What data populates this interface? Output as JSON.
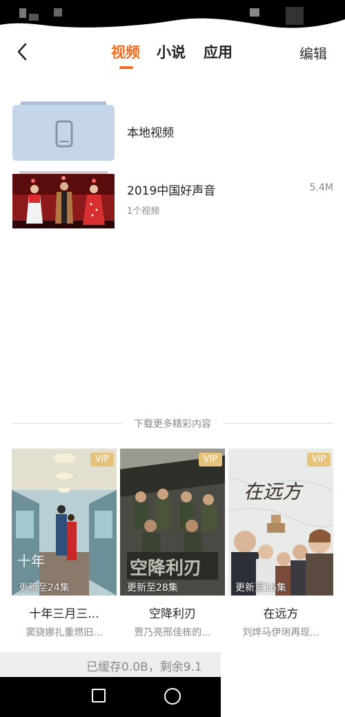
{
  "header": {
    "tabs": [
      {
        "label": "视频",
        "active": true
      },
      {
        "label": "小说",
        "active": false
      },
      {
        "label": "应用",
        "active": false
      }
    ],
    "edit_label": "编辑",
    "accent_color": "#f26b1d"
  },
  "local_video": {
    "label": "本地视频",
    "icon": "phone-icon"
  },
  "folder": {
    "title": "2019中国好声音",
    "count": "1个视频",
    "size": "5.4M"
  },
  "divider_text": "下载更多精彩内容",
  "cards": [
    {
      "badge": "VIP",
      "update": "更新至24集",
      "title": "十年三月三...",
      "subtitle": "窦骁娜扎重燃旧..."
    },
    {
      "badge": "VIP",
      "update": "更新至28集",
      "title": "空降利刃",
      "subtitle": "贾乃亮邢佳栋的..."
    },
    {
      "badge": "VIP",
      "update": "更新至16集",
      "title": "在远方",
      "subtitle": "刘烨马伊琍再现..."
    }
  ],
  "storage_text": "已缓存0.0B，剩余9.1"
}
